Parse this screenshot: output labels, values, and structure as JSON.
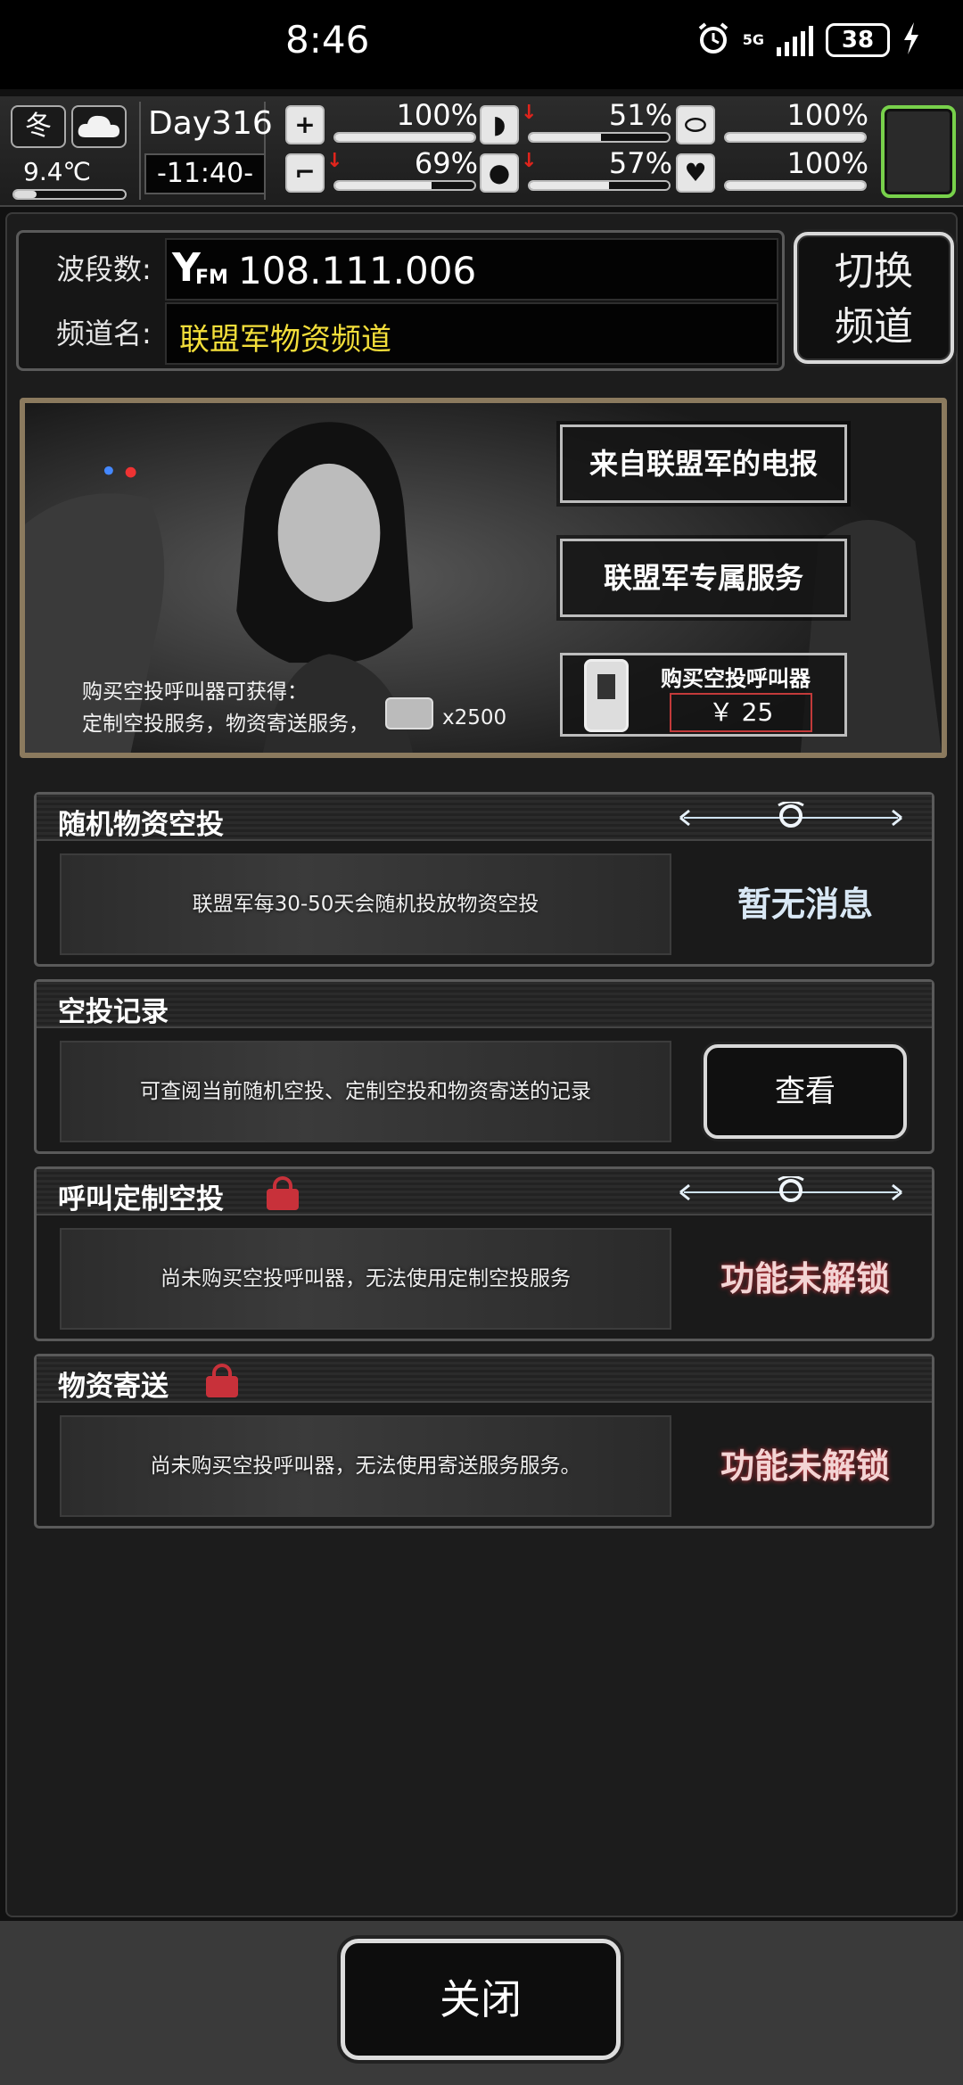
{
  "statusbar": {
    "time": "8:46",
    "network": "5G",
    "battery": "38",
    "icons": [
      "alarm-icon",
      "signal-icon",
      "battery-icon",
      "charging-icon"
    ]
  },
  "hud": {
    "season": "冬",
    "weather_icon": "cloud-icon",
    "temperature": "9.4℃",
    "temperature_level": 0.2,
    "day": "Day316",
    "clock": "-11:40-",
    "stats": [
      {
        "name": "health",
        "icon": "medkit-icon",
        "value": "100%",
        "level": 1.0,
        "decreasing": false
      },
      {
        "name": "hunger",
        "icon": "stomach-icon",
        "value": "51%",
        "level": 0.51,
        "decreasing": true
      },
      {
        "name": "mood",
        "icon": "capsule-icon",
        "value": "100%",
        "level": 1.0,
        "decreasing": false
      },
      {
        "name": "stamina",
        "icon": "boot-icon",
        "value": "69%",
        "level": 0.69,
        "decreasing": true
      },
      {
        "name": "thirst",
        "icon": "water-drop-icon",
        "value": "57%",
        "level": 0.57,
        "decreasing": true
      },
      {
        "name": "spirit",
        "icon": "heart-icon",
        "value": "100%",
        "level": 1.0,
        "decreasing": false
      }
    ]
  },
  "radio": {
    "band_label": "波段数:",
    "band_prefix": "FM",
    "band_value": "108.111.006",
    "channel_label": "频道名:",
    "channel_value": "联盟军物资频道",
    "switch_line1": "切换",
    "switch_line2": "频道"
  },
  "banner": {
    "btn_telegram": "来自联盟军的电报",
    "btn_service": "联盟军专属服务",
    "buy_label": "购买空投呼叫器",
    "buy_price": "￥ 25",
    "info_line1": "购买空投呼叫器可获得：",
    "info_line2": "定制空投服务，物资寄送服务，",
    "info_count": "x2500"
  },
  "sections": {
    "random": {
      "title": "随机物资空投",
      "desc": "联盟军每30-50天会随机投放物资空投",
      "status": "暂无消息"
    },
    "record": {
      "title": "空投记录",
      "desc": "可查阅当前随机空投、定制空投和物资寄送的记录",
      "button": "查看"
    },
    "custom": {
      "title": "呼叫定制空投",
      "desc": "尚未购买空投呼叫器，无法使用定制空投服务",
      "status": "功能未解锁"
    },
    "delivery": {
      "title": "物资寄送",
      "desc": "尚未购买空投呼叫器，无法使用寄送服务服务。",
      "status": "功能未解锁"
    }
  },
  "close_label": "关闭",
  "colors": {
    "channel_text": "#f3de3a",
    "locked_red": "#c8313a",
    "slot_green": "#78d14b",
    "banner_frame": "#8b7a5e"
  }
}
